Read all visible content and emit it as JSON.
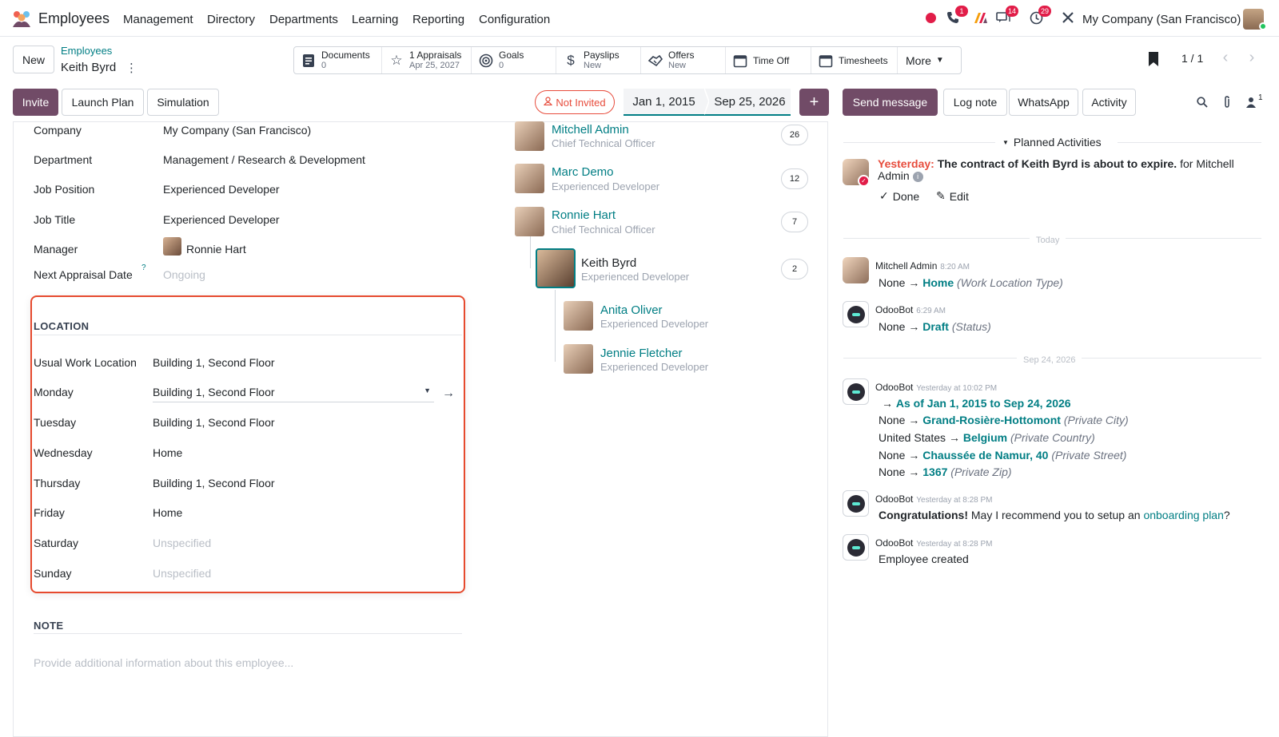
{
  "navbar": {
    "app_name": "Employees",
    "menu": [
      "Management",
      "Directory",
      "Departments",
      "Learning",
      "Reporting",
      "Configuration"
    ],
    "badges": {
      "calls": "1",
      "messages": "14",
      "activities": "29"
    },
    "company": "My Company (San Francisco)"
  },
  "control": {
    "new_label": "New",
    "breadcrumb_parent": "Employees",
    "record_name": "Keith Byrd",
    "pager": "1 / 1"
  },
  "smart_buttons": {
    "documents": {
      "title": "Documents",
      "value": "0"
    },
    "appraisals": {
      "title": "1 Appraisals",
      "value": "Apr 25, 2027"
    },
    "goals": {
      "title": "Goals",
      "value": "0"
    },
    "payslips": {
      "title": "Payslips",
      "value": "New"
    },
    "offers": {
      "title": "Offers",
      "value": "New"
    },
    "timeoff": {
      "title": "Time Off"
    },
    "timesheets": {
      "title": "Timesheets"
    },
    "more": "More"
  },
  "actions": {
    "invite": "Invite",
    "launch_plan": "Launch Plan",
    "simulation": "Simulation",
    "status": "Not Invited",
    "date_start": "Jan 1, 2015",
    "date_end": "Sep 25, 2026",
    "add": "+"
  },
  "form": {
    "company": {
      "label": "Company",
      "value": "My Company (San Francisco)"
    },
    "department": {
      "label": "Department",
      "value": "Management / Research & Development"
    },
    "job_position": {
      "label": "Job Position",
      "value": "Experienced Developer"
    },
    "job_title": {
      "label": "Job Title",
      "value": "Experienced Developer"
    },
    "manager": {
      "label": "Manager",
      "value": "Ronnie Hart"
    },
    "next_appraisal": {
      "label": "Next Appraisal Date",
      "help": "?",
      "placeholder": "Ongoing"
    },
    "location": {
      "title": "LOCATION",
      "rows": [
        {
          "label": "Usual Work Location",
          "value": "Building 1, Second Floor"
        },
        {
          "label": "Monday",
          "value": "Building 1, Second Floor"
        },
        {
          "label": "Tuesday",
          "value": "Building 1, Second Floor"
        },
        {
          "label": "Wednesday",
          "value": "Home"
        },
        {
          "label": "Thursday",
          "value": "Building 1, Second Floor"
        },
        {
          "label": "Friday",
          "value": "Home"
        },
        {
          "label": "Saturday",
          "value": "Unspecified"
        },
        {
          "label": "Sunday",
          "value": "Unspecified"
        }
      ]
    },
    "note": {
      "title": "NOTE",
      "placeholder": "Provide additional information about this employee..."
    }
  },
  "org_chart": [
    {
      "name": "Mitchell Admin",
      "job": "Chief Technical Officer",
      "count": "26"
    },
    {
      "name": "Marc Demo",
      "job": "Experienced Developer",
      "count": "12"
    },
    {
      "name": "Ronnie Hart",
      "job": "Chief Technical Officer",
      "count": "7"
    },
    {
      "name": "Keith Byrd",
      "job": "Experienced Developer",
      "count": "2"
    },
    {
      "name": "Anita Oliver",
      "job": "Experienced Developer"
    },
    {
      "name": "Jennie Fletcher",
      "job": "Experienced Developer"
    }
  ],
  "chatter": {
    "send_message": "Send message",
    "log_note": "Log note",
    "whatsapp": "WhatsApp",
    "activity": "Activity",
    "followers": "1",
    "planned_title": "Planned Activities",
    "planned": {
      "when": "Yesterday:",
      "summary": "The contract of Keith Byrd is about to expire.",
      "for_text": "for Mitchell",
      "for_text_2": "Admin",
      "done": "Done",
      "edit": "Edit"
    },
    "sep_today": "Today",
    "sep_date": "Sep 24, 2026",
    "messages": [
      {
        "author": "Mitchell Admin",
        "time": "8:20 AM"
      },
      {
        "author": "OdooBot",
        "time": "6:29 AM"
      },
      {
        "author": "OdooBot",
        "time": "Yesterday at 10:02 PM"
      },
      {
        "author": "OdooBot",
        "time": "Yesterday at 8:28 PM"
      },
      {
        "author": "OdooBot",
        "time": "Yesterday at 8:28 PM"
      }
    ],
    "m1": {
      "old": "None",
      "new": "Home",
      "field": "(Work Location Type)"
    },
    "m2": {
      "old": "None",
      "new": "Draft",
      "field": "(Status)"
    },
    "m3": {
      "period": "As of Jan 1, 2015 to Sep 24, 2026",
      "c1_old": "None",
      "c1_new": "Grand-Rosière-Hottomont",
      "c1_field": "(Private City)",
      "c2_old": "United States",
      "c2_new": "Belgium",
      "c2_field": "(Private Country)",
      "c3_old": "None",
      "c3_new": "Chaussée de Namur, 40",
      "c3_field": "(Private Street)",
      "c4_old": "None",
      "c4_new": "1367",
      "c4_field": "(Private Zip)"
    },
    "m4": {
      "bold": "Congratulations!",
      "text": "May I recommend you to setup an",
      "link": "onboarding plan",
      "end": "?"
    },
    "m5": {
      "text": "Employee created"
    },
    "arrow": "→"
  }
}
